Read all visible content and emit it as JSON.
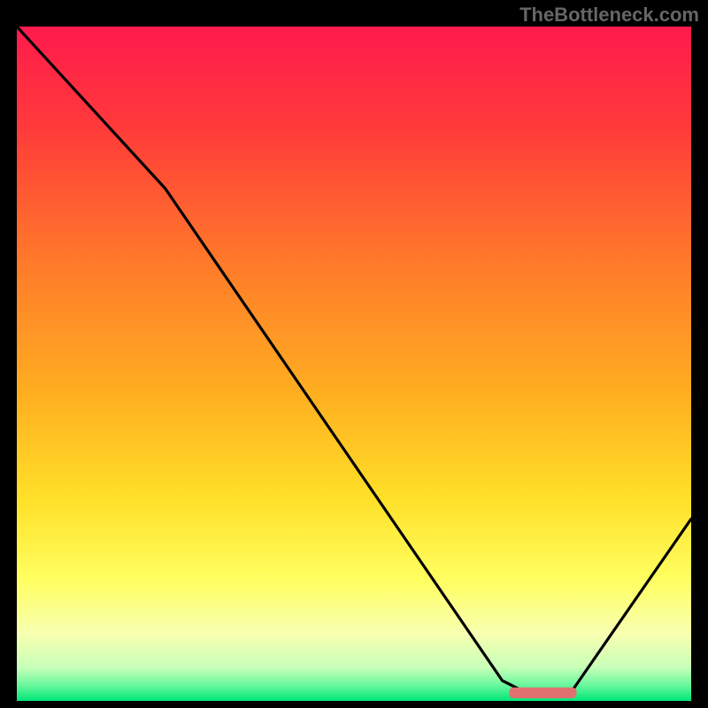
{
  "attribution": "TheBottleneck.com",
  "colors": {
    "border": "#000000",
    "curve": "#000000",
    "marker": "#e17070",
    "gradient_stops": [
      {
        "offset": 0.0,
        "color": "#ff1a4d"
      },
      {
        "offset": 0.15,
        "color": "#ff3a3a"
      },
      {
        "offset": 0.35,
        "color": "#ff7a2a"
      },
      {
        "offset": 0.55,
        "color": "#ffb020"
      },
      {
        "offset": 0.7,
        "color": "#ffe028"
      },
      {
        "offset": 0.82,
        "color": "#ffff60"
      },
      {
        "offset": 0.9,
        "color": "#f8ffb0"
      },
      {
        "offset": 0.95,
        "color": "#c8ffb8"
      },
      {
        "offset": 0.975,
        "color": "#70f8a0"
      },
      {
        "offset": 1.0,
        "color": "#00e676"
      }
    ]
  },
  "chart_data": {
    "type": "line",
    "title": "",
    "xlabel": "",
    "ylabel": "",
    "xlim": [
      0,
      100
    ],
    "ylim": [
      0,
      100
    ],
    "legend": false,
    "grid": false,
    "curve_points": [
      {
        "x": 0,
        "y": 100
      },
      {
        "x": 22,
        "y": 76
      },
      {
        "x": 72,
        "y": 3
      },
      {
        "x": 76,
        "y": 1
      },
      {
        "x": 82,
        "y": 1
      },
      {
        "x": 100,
        "y": 27
      }
    ],
    "marker": {
      "x_start": 73,
      "x_end": 83,
      "y": 1.2,
      "height": 1.6
    }
  }
}
